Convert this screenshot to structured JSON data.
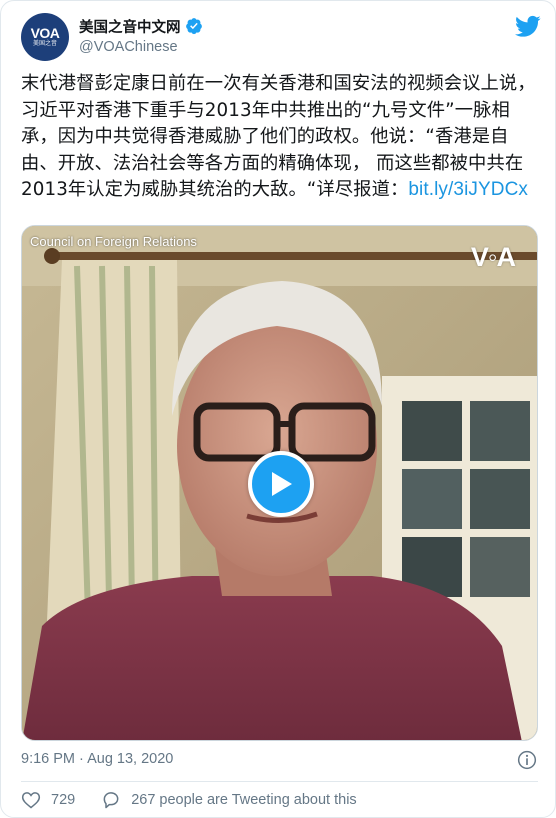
{
  "account": {
    "display_name": "美国之音中文网",
    "handle": "@VOAChinese",
    "avatar_logo": "VOA",
    "avatar_sub": "美国之音"
  },
  "tweet": {
    "text": "末代港督彭定康日前在一次有关香港和国安法的视频会议上说，习近平对香港下重手与2013年中共推出的“九号文件”一脉相承，因为中共觉得香港威胁了他们的政权。他说：“香港是自由、开放、法治社会等各方面的精确体现， 而这些都被中共在2013年认定为威胁其统治的大敌。“详尽报道：",
    "link": "bit.ly/3iJYDCx",
    "timestamp": "9:16 PM · Aug 13, 2020"
  },
  "media": {
    "caption": "Council on Foreign Relations",
    "watermark": "V◦A"
  },
  "actions": {
    "likes": "729",
    "retweet_text": "267 people are Tweeting about this"
  },
  "colors": {
    "accent": "#1da1f2",
    "link": "#1b95e0",
    "muted": "#657786"
  }
}
